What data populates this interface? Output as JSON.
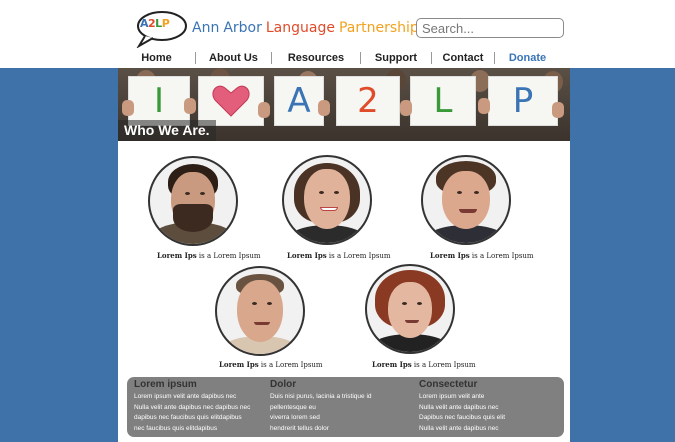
{
  "logo": {
    "text": "A2LP"
  },
  "brand": {
    "words": [
      "Ann",
      "Arbor",
      "Language",
      "Partnership"
    ],
    "colors": [
      "#3a74b5",
      "#3a74b5",
      "#e04b2a",
      "#f2a21f"
    ]
  },
  "search": {
    "placeholder": "Search..."
  },
  "nav": {
    "home": "Home",
    "about": "About Us",
    "resources": "Resources",
    "support": "Support",
    "contact": "Contact",
    "donate": "Donate"
  },
  "banner": {
    "letters": [
      "I",
      "",
      "A",
      "2",
      "L",
      "P"
    ],
    "title": "Who We Are."
  },
  "team": [
    {
      "name": "Lorem Ips",
      "desc": " is a Lorem Ipsum"
    },
    {
      "name": "Lorem Ips",
      "desc": " is a Lorem Ipsum"
    },
    {
      "name": "Lorem Ips",
      "desc": " is a Lorem Ipsum"
    },
    {
      "name": "Lorem Ips",
      "desc": " is a Lorem Ipsum"
    },
    {
      "name": "Lorem Ips",
      "desc": " is a Lorem Ipsum"
    }
  ],
  "footer": {
    "col1": {
      "title": "Lorem ipsum",
      "lines": [
        "Lorem ipsum velit ante dapibus nec",
        "Nulla velit ante dapibus nec dapibus nec",
        "dapibus nec faucibus quis elitdapibus",
        "nec faucibus quis elitdapibus"
      ]
    },
    "col2": {
      "title": "Dolor",
      "lines": [
        "Duis nisi purus, lacinia a tristique id",
        "pellentesque eu",
        "viverra lorem sed",
        "hendrerit tellus dolor"
      ]
    },
    "col3": {
      "title": "Consectetur",
      "lines": [
        "Lorem ipsum velit ante",
        "Nulla velit ante dapibus nec",
        "Dapibus nec faucibus quis elit",
        "Nulla velit ante dapibus nec"
      ]
    }
  },
  "colors": {
    "blue_bg": "#3f72a9",
    "footer_bg": "#808080",
    "donate": "#3a74b5"
  }
}
